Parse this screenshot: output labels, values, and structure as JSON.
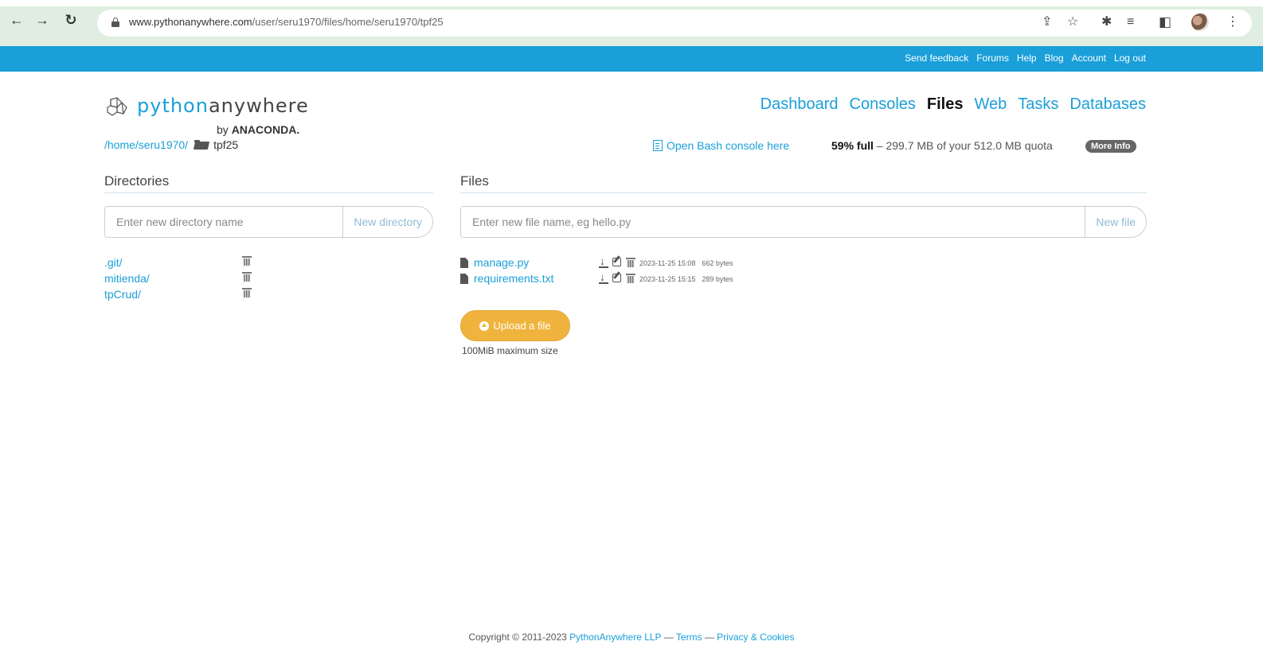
{
  "browser": {
    "url_domain": "www.pythonanywhere.com",
    "url_path": "/user/seru1970/files/home/seru1970/tpf25",
    "icons": [
      "back-icon",
      "forward-icon",
      "reload-icon",
      "lock-icon",
      "share-icon",
      "star-icon",
      "extensions-icon",
      "reading-list-icon",
      "side-panel-icon",
      "profile-avatar",
      "menu-icon"
    ]
  },
  "topbar": {
    "links": [
      "Send feedback",
      "Forums",
      "Help",
      "Blog",
      "Account",
      "Log out"
    ]
  },
  "logo": {
    "python": "python",
    "anywhere": "anywhere",
    "by": "by",
    "anaconda": "ANACONDA."
  },
  "nav": {
    "items": [
      "Dashboard",
      "Consoles",
      "Files",
      "Web",
      "Tasks",
      "Databases"
    ],
    "active": "Files"
  },
  "breadcrumb": {
    "path": "/home/seru1970/",
    "current": "tpf25"
  },
  "bash_link": "Open Bash console here",
  "quota": {
    "percent": "59% full",
    "detail": " – 299.7 MB of your 512.0 MB quota",
    "more_info": "More Info"
  },
  "directories": {
    "title": "Directories",
    "placeholder": "Enter new directory name",
    "button": "New directory",
    "items": [
      ".git/",
      "mitienda/",
      "tpCrud/"
    ]
  },
  "files": {
    "title": "Files",
    "placeholder": "Enter new file name, eg hello.py",
    "button": "New file",
    "items": [
      {
        "name": "manage.py",
        "date": "2023-11-25 15:08",
        "size": "662 bytes"
      },
      {
        "name": "requirements.txt",
        "date": "2023-11-25 15:15",
        "size": "289 bytes"
      }
    ],
    "upload_label": "Upload a file",
    "upload_note": "100MiB maximum size"
  },
  "footer": {
    "copyright": "Copyright © 2011-2023 ",
    "company": "PythonAnywhere LLP",
    "sep1": " — ",
    "terms": "Terms",
    "sep2": " — ",
    "privacy": "Privacy & Cookies"
  },
  "colors": {
    "brand_blue": "#1a9fd9",
    "upload_orange": "#f0b43e",
    "browser_chrome": "#dfeee0"
  }
}
